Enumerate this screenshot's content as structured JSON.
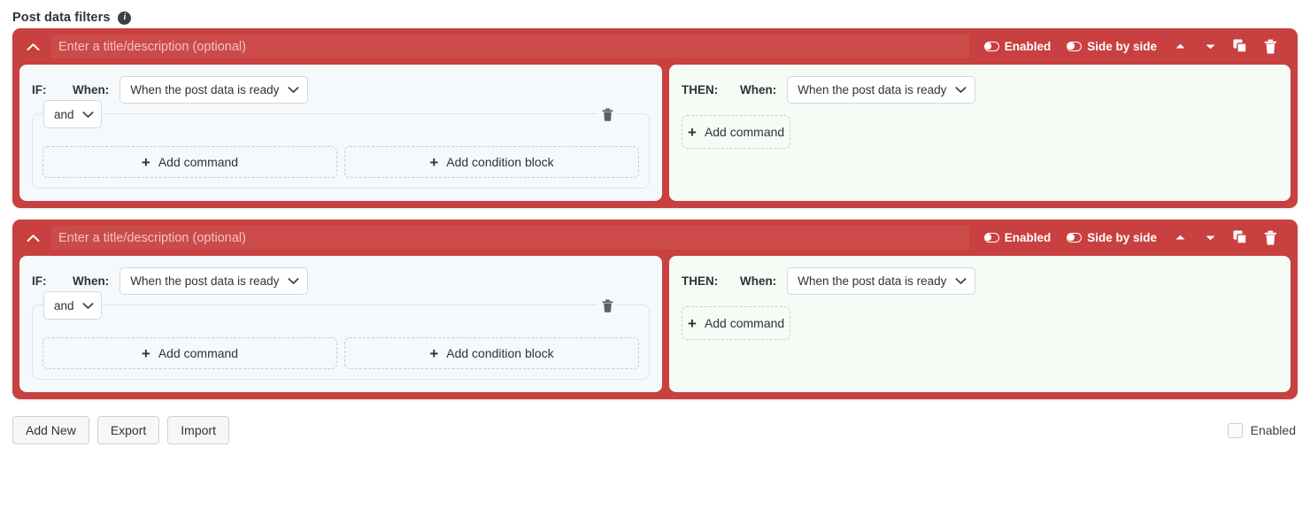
{
  "page": {
    "title": "Post data filters",
    "info_icon": "info-icon",
    "info_glyph": "i"
  },
  "colors": {
    "card_red": "#c8403f",
    "if_panel_bg": "#f5f9fc",
    "then_panel_bg": "#f5fbf5",
    "text": "#2f3337"
  },
  "card_common": {
    "collapse_icon": "chevron-up-icon",
    "title_placeholder": "Enter a title/description (optional)",
    "title_value": "",
    "toggles": [
      {
        "label": "Enabled",
        "icon": "toggle-switch-icon"
      },
      {
        "label": "Side by side",
        "icon": "toggle-switch-icon"
      }
    ],
    "tools": [
      {
        "name": "move-up-icon"
      },
      {
        "name": "move-down-icon"
      },
      {
        "name": "duplicate-icon"
      },
      {
        "name": "delete-icon"
      }
    ],
    "if": {
      "label": "IF:",
      "when_label": "When:",
      "when_value": "When the post data is ready",
      "dropdown_icon": "chevron-down-icon",
      "condition": {
        "operator": "and",
        "operator_icon": "chevron-down-icon",
        "delete_icon": "trash-icon",
        "buttons": [
          {
            "label": "Add command",
            "icon": "plus-icon",
            "glyph": "+"
          },
          {
            "label": "Add condition block",
            "icon": "plus-icon",
            "glyph": "+"
          }
        ]
      }
    },
    "then": {
      "label": "THEN:",
      "when_label": "When:",
      "when_value": "When the post data is ready",
      "dropdown_icon": "chevron-down-icon",
      "add_command": {
        "label": "Add command",
        "icon": "plus-icon",
        "glyph": "+"
      }
    }
  },
  "cards": [
    {
      "index": 1
    },
    {
      "index": 2
    }
  ],
  "footer": {
    "buttons": [
      {
        "label": "Add New"
      },
      {
        "label": "Export"
      },
      {
        "label": "Import"
      }
    ],
    "enabled_checkbox": {
      "label": "Enabled",
      "checked": false
    }
  }
}
